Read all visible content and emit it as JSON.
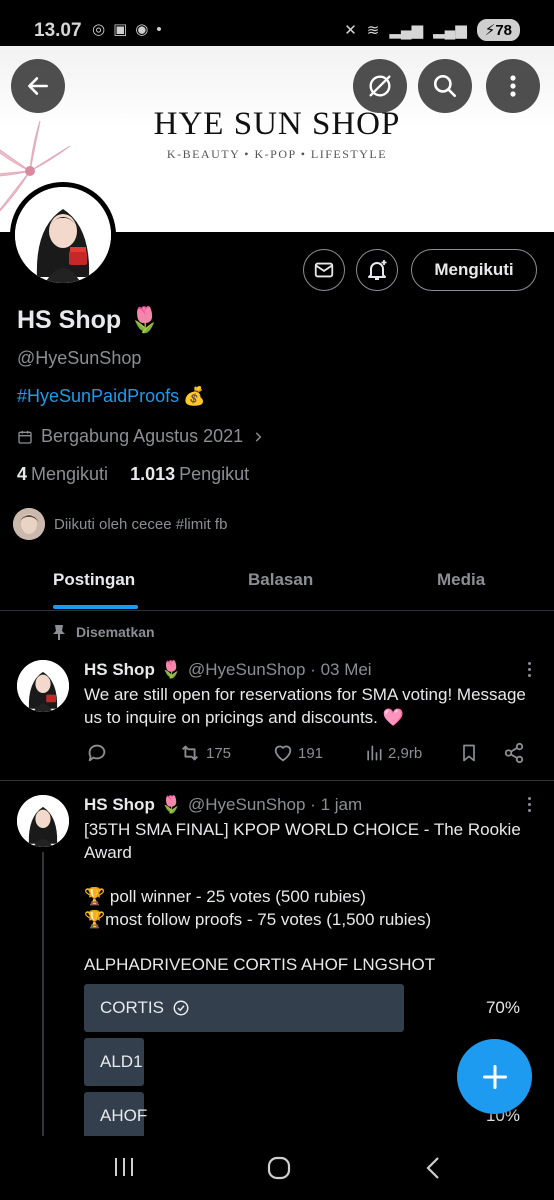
{
  "status_bar": {
    "time": "13.07",
    "battery": "78"
  },
  "banner": {
    "shop_name": "HYE SUN SHOP",
    "tagline": "K-BEAUTY • K-POP • LIFESTYLE"
  },
  "profile": {
    "display_name": "HS Shop",
    "name_emoji": "🌷",
    "handle": "@HyeSunShop",
    "hashtag": "#HyeSunPaidProofs",
    "hashtag_emoji": "💰",
    "joined": "Bergabung Agustus 2021",
    "following_count": "4",
    "following_label": "Mengikuti",
    "followers_count": "1.013",
    "followers_label": "Pengikut",
    "followed_by": "Diikuti oleh cecee #limit fb",
    "follow_button": "Mengikuti"
  },
  "tabs": [
    {
      "label": "Postingan",
      "active": true
    },
    {
      "label": "Balasan",
      "active": false
    },
    {
      "label": "Media",
      "active": false
    }
  ],
  "pinned_label": "Disematkan",
  "tweets": [
    {
      "name": "HS Shop",
      "emoji": "🌷",
      "meta": "@HyeSunShop · 03 Mei",
      "text": "We are still open for reservations for SMA voting! Message us to inquire on pricings and discounts. 🩷",
      "retweets": "175",
      "likes": "191",
      "views": "2,9rb"
    },
    {
      "name": "HS Shop",
      "emoji": "🌷",
      "meta": "@HyeSunShop · 1 jam",
      "line1": "[35TH SMA FINAL] KPOP WORLD CHOICE - The Rookie Award",
      "line2": "🏆 poll winner - 25 votes (500 rubies)",
      "line3": "🏆most follow proofs - 75 votes (1,500 rubies)",
      "line4": "ALPHADRIVEONE CORTIS AHOF LNGSHOT",
      "poll": [
        {
          "label": "CORTIS",
          "percent": "70%",
          "value": 0.7,
          "selected": true
        },
        {
          "label": "ALD1",
          "percent": "",
          "value": 0.1,
          "selected": false
        },
        {
          "label": "AHOF",
          "percent": "10%",
          "value": 0.1,
          "selected": false
        }
      ]
    }
  ],
  "colors": {
    "accent": "#1d9bf0",
    "muted": "#8b8f93",
    "poll_bar": "#333f4d"
  }
}
